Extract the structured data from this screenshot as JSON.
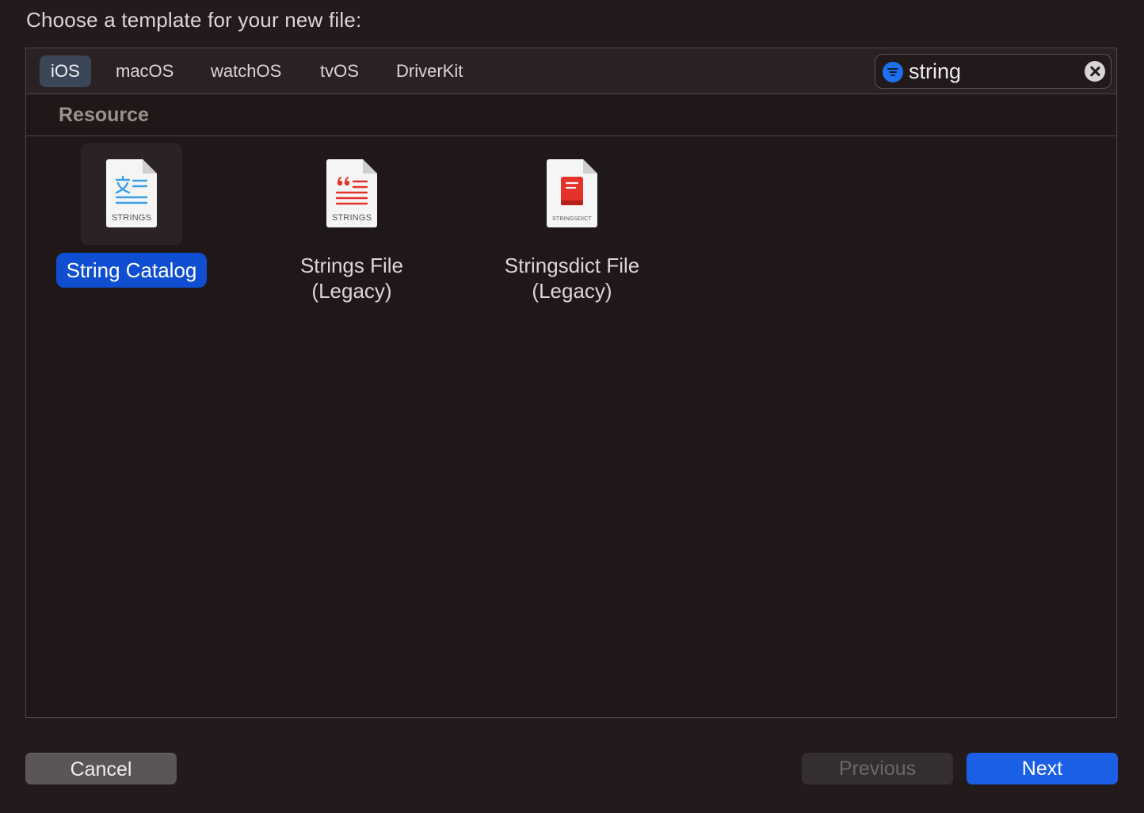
{
  "dialog": {
    "heading": "Choose a template for your new file:"
  },
  "platform_tabs": [
    {
      "label": "iOS",
      "active": true
    },
    {
      "label": "macOS",
      "active": false
    },
    {
      "label": "watchOS",
      "active": false
    },
    {
      "label": "tvOS",
      "active": false
    },
    {
      "label": "DriverKit",
      "active": false
    }
  ],
  "search": {
    "value": "string",
    "filter_icon": "filter-icon",
    "clear_icon": "clear-icon"
  },
  "section": {
    "title": "Resource"
  },
  "templates": [
    {
      "title": "String Catalog",
      "icon": "string-catalog-icon",
      "badge": "STRINGS",
      "selected": true
    },
    {
      "title": "Strings File (Legacy)",
      "title_lines": [
        "Strings File",
        "(Legacy)"
      ],
      "icon": "strings-file-icon",
      "badge": "STRINGS",
      "selected": false
    },
    {
      "title": "Stringsdict File (Legacy)",
      "title_lines": [
        "Stringsdict File",
        "(Legacy)"
      ],
      "icon": "stringsdict-file-icon",
      "badge": "STRINGSDICT",
      "selected": false
    }
  ],
  "buttons": {
    "cancel": "Cancel",
    "previous": "Previous",
    "next": "Next"
  },
  "colors": {
    "accent": "#1a5fe6",
    "selection": "#0f4ed0",
    "catalog_blue": "#3aa0e8",
    "strings_red": "#e5322a",
    "background": "#231b1b"
  }
}
